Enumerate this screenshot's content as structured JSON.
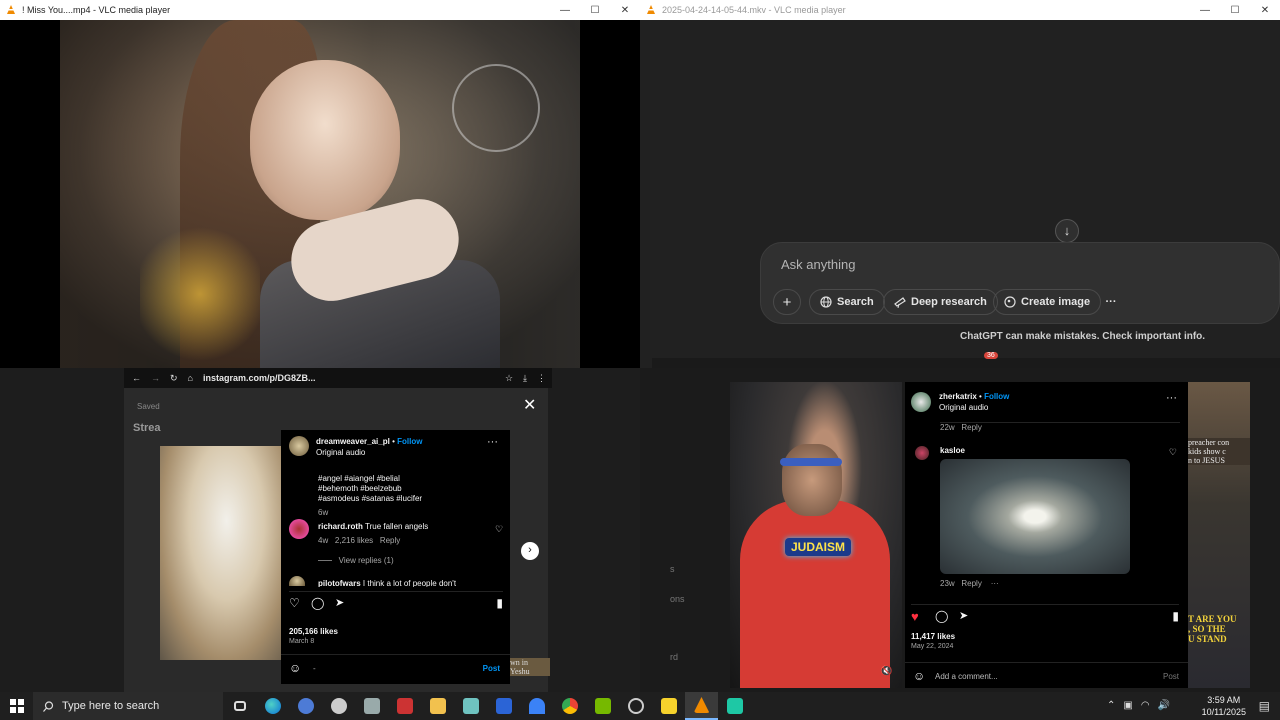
{
  "window_left": {
    "title": "! Miss You....mp4 - VLC media player",
    "minimize": "—",
    "maximize": "☐",
    "close": "✕"
  },
  "window_right": {
    "title": "2025-04-24-14-05-44.mkv - VLC media player",
    "minimize": "—",
    "maximize": "☐",
    "close": "✕"
  },
  "chatgpt": {
    "scroll_down": "↓",
    "placeholder": "Ask anything",
    "plus": "+",
    "search": "Search",
    "deep_research": "Deep research",
    "create_image": "Create image",
    "more": "···",
    "disclaimer": "ChatGPT can make mistakes. Check important info."
  },
  "browser_left": {
    "url": "instagram.com/p/DG8ZB...",
    "saved": "Saved",
    "stream": "Strea"
  },
  "ig_left": {
    "username": "dreamweaver_ai_pl",
    "follow": "Follow",
    "audio": "Original audio",
    "hashtags_1": "#angel #aiangel #belial",
    "hashtags_2": "#behemoth #beelzebub",
    "hashtags_3": "#asmodeus #satanas #lucifer",
    "caption_age": "6w",
    "comment1_user": "richard.roth",
    "comment1_text": "True fallen angels",
    "comment1_age": "4w",
    "comment1_likes": "2,216 likes",
    "reply": "Reply",
    "view_replies": "View replies (1)",
    "comment2_user": "pilotofwars",
    "comment2_text": "I think a lot of people don't",
    "likes": "205,166 likes",
    "date": "March 8",
    "comment_placeholder": "-",
    "post": "Post",
    "close": "✕",
    "next": "›",
    "side_text": "wn in\nYeshu"
  },
  "ig_right": {
    "username": "zherkatrix",
    "follow": "Follow",
    "audio": "Original audio",
    "top_age": "22w",
    "reply": "Reply",
    "comment_user": "kasloe",
    "comment_age": "23w",
    "comment_more": "···",
    "likes": "11,417 likes",
    "date": "May 22, 2024",
    "add_comment": "Add a comment...",
    "post": "Post",
    "overlay_text": "JUDAISM",
    "left_labels": [
      "s",
      "ons",
      "rd"
    ],
    "side_text_1": "preacher con\nkids show c\nn to JESUS",
    "side_text_2": "T ARE YOU\n, SO THE\nU STAND"
  },
  "taskbar": {
    "search_placeholder": "Type here to search",
    "time": "3:59 AM",
    "date": "10/11/2025",
    "badge_count": "36"
  },
  "colors": {
    "ig_blue": "#0095f6",
    "liked_red": "#ff3040",
    "chatgpt_bg": "#212121",
    "taskbar_bg": "#1f1f1f"
  }
}
